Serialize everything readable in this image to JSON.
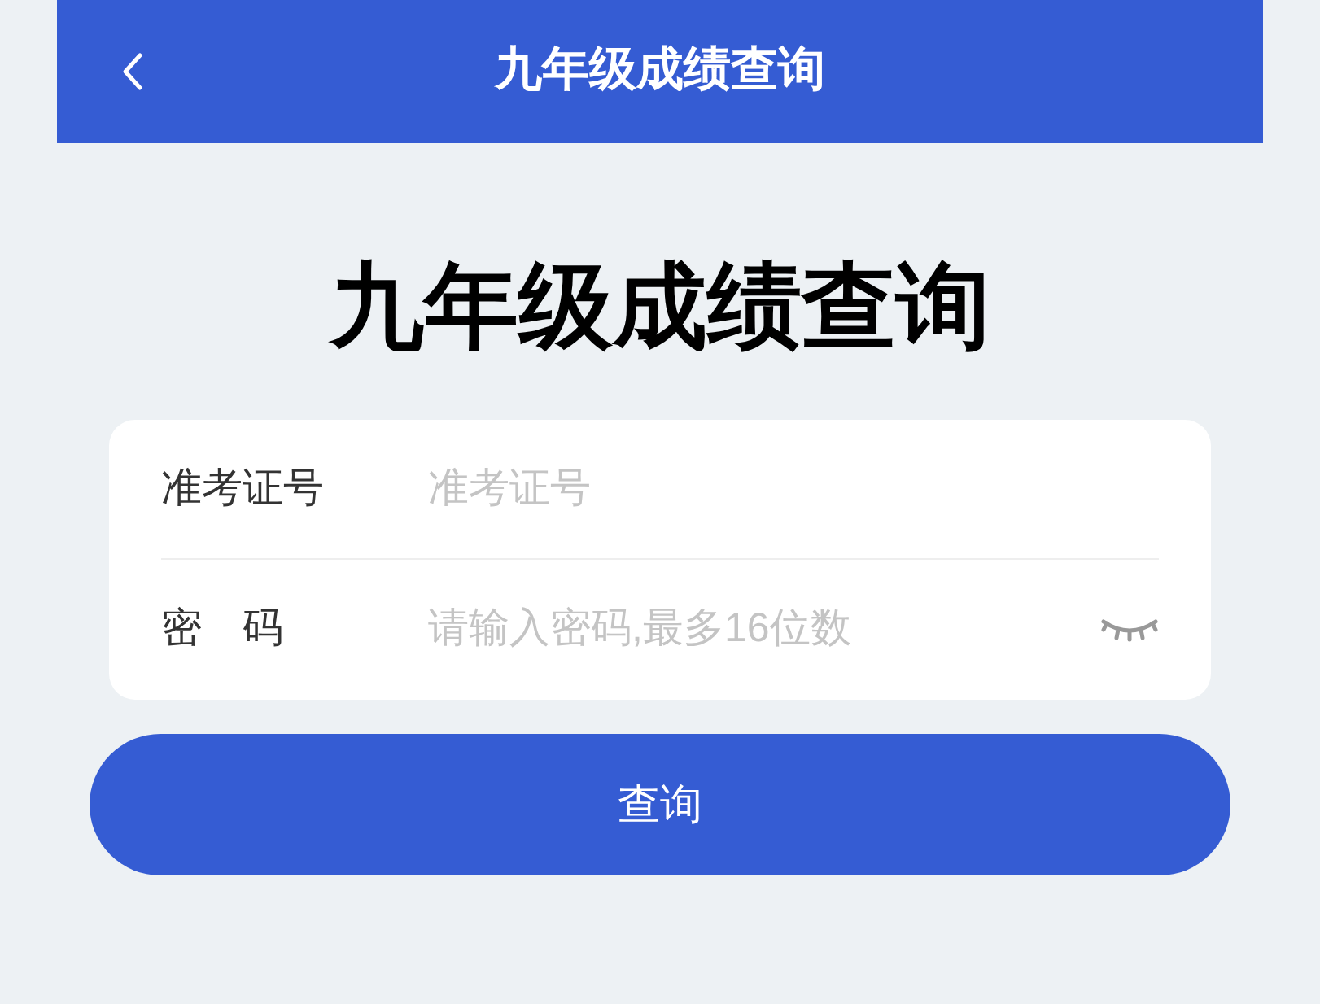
{
  "header": {
    "title": "九年级成绩查询"
  },
  "heading": "九年级成绩查询",
  "fields": [
    {
      "kind": "text",
      "label": "准考证号",
      "placeholder": "准考证号"
    },
    {
      "kind": "password",
      "label": "密　码",
      "placeholder": "请输入密码,最多16位数",
      "password_visible": false
    }
  ],
  "submit_button": "查询"
}
